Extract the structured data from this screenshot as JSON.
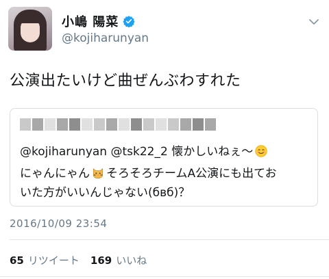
{
  "user": {
    "display_name": "小嶋 陽菜",
    "handle": "@kojiharunyan",
    "verified": true
  },
  "tweet": {
    "text": "公演出たいけど曲ぜんぶわすれた",
    "timestamp": "2016/10/09 23:54"
  },
  "quote": {
    "author_name": "",
    "line1": "@kojiharunyan @tsk22_2 懐かしいねぇ〜",
    "line2_a": "にゃんにゃん",
    "line2_b": "そろそろチームA公演にも出てお",
    "line3": "いた方がいいんじゃない(бвб)？"
  },
  "stats": {
    "retweets_count": "65",
    "retweets_label": "リツイート",
    "likes_count": "169",
    "likes_label": "いいね"
  },
  "icons": {
    "verified": "verified-badge-icon",
    "menu": "chevron-down-icon",
    "smile": "smiling-face-emoji",
    "cat": "cat-face-emoji"
  },
  "colors": {
    "text": "#14171a",
    "secondary": "#657786",
    "verified_blue": "#1da1f2",
    "border": "#d8dee2"
  }
}
